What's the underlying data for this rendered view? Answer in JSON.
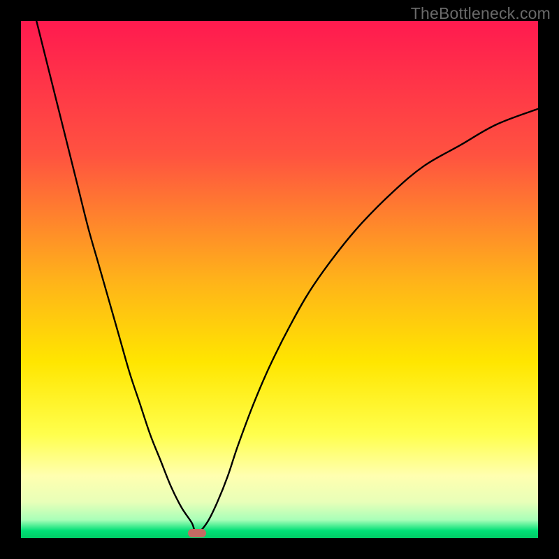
{
  "watermark": "TheBottleneck.com",
  "chart_data": {
    "type": "line",
    "title": "",
    "xlabel": "",
    "ylabel": "",
    "xlim": [
      0,
      100
    ],
    "ylim": [
      0,
      100
    ],
    "background": {
      "gradient_stops": [
        {
          "pct": 0,
          "color": "#ff1a4f"
        },
        {
          "pct": 26,
          "color": "#ff5340"
        },
        {
          "pct": 50,
          "color": "#ffb21a"
        },
        {
          "pct": 66,
          "color": "#ffe600"
        },
        {
          "pct": 80,
          "color": "#ffff4d"
        },
        {
          "pct": 88,
          "color": "#ffffb0"
        },
        {
          "pct": 93,
          "color": "#e8ffb8"
        },
        {
          "pct": 96.5,
          "color": "#a8ffb8"
        },
        {
          "pct": 98.6,
          "color": "#00e076"
        },
        {
          "pct": 100,
          "color": "#00cc66"
        }
      ]
    },
    "optimum_x": 34,
    "optimum_y": 99,
    "marker": {
      "x": 34,
      "y": 99,
      "color": "#c46a63"
    },
    "series": [
      {
        "name": "bottleneck-curve",
        "x": [
          3,
          5,
          7,
          9,
          11,
          13,
          15,
          17,
          19,
          21,
          23,
          25,
          27,
          29,
          31,
          33,
          34,
          36,
          38,
          40,
          42,
          45,
          48,
          52,
          56,
          61,
          66,
          72,
          78,
          85,
          92,
          100
        ],
        "y": [
          0,
          8,
          16,
          24,
          32,
          40,
          47,
          54,
          61,
          68,
          74,
          80,
          85,
          90,
          94,
          97,
          99,
          97,
          93,
          88,
          82,
          74,
          67,
          59,
          52,
          45,
          39,
          33,
          28,
          24,
          20,
          17
        ]
      }
    ]
  }
}
